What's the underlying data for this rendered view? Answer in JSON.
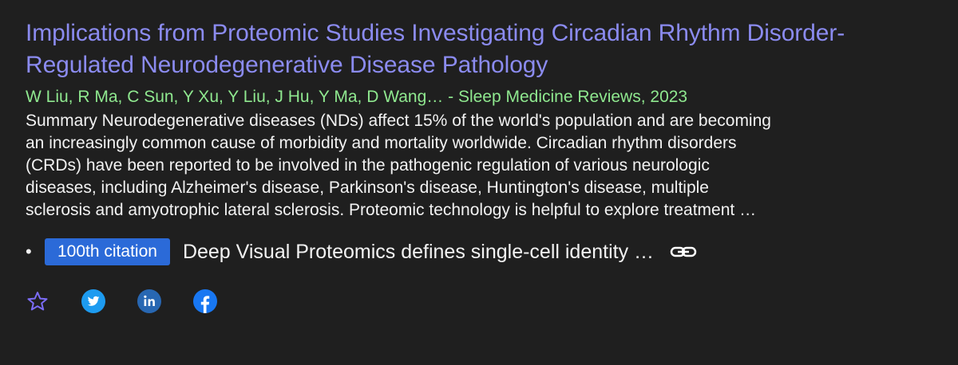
{
  "result": {
    "title": "Implications from Proteomic Studies Investigating Circadian Rhythm Disorder-Regulated Neurodegenerative Disease Pathology",
    "authors": "W Liu, R Ma, C Sun, Y Xu, Y Liu, J Hu, Y Ma, D Wang… - Sleep Medicine Reviews, 2023",
    "snippet": "Summary Neurodegenerative diseases (NDs) affect 15% of the world's population and are becoming an increasingly common cause of morbidity and mortality worldwide. Circadian rhythm disorders (CRDs) have been reported to be involved in the pathogenic regulation of various neurologic diseases, including Alzheimer's disease, Parkinson's disease, Huntington's disease, multiple sclerosis and amyotrophic lateral sclerosis. Proteomic technology is helpful to explore treatment …"
  },
  "citation": {
    "bullet": "•",
    "badge": "100th citation",
    "title": "Deep Visual Proteomics defines single-cell identity …"
  },
  "share": {
    "icons": [
      "star-icon",
      "twitter-icon",
      "linkedin-icon",
      "facebook-icon"
    ]
  },
  "colors": {
    "background": "#1f1f1f",
    "title": "#8b8bf0",
    "authors": "#8fe88f",
    "badge": "#2b6ad8",
    "twitter": "#1d9bf0",
    "linkedin": "#2867b2",
    "facebook": "#1877f2"
  }
}
